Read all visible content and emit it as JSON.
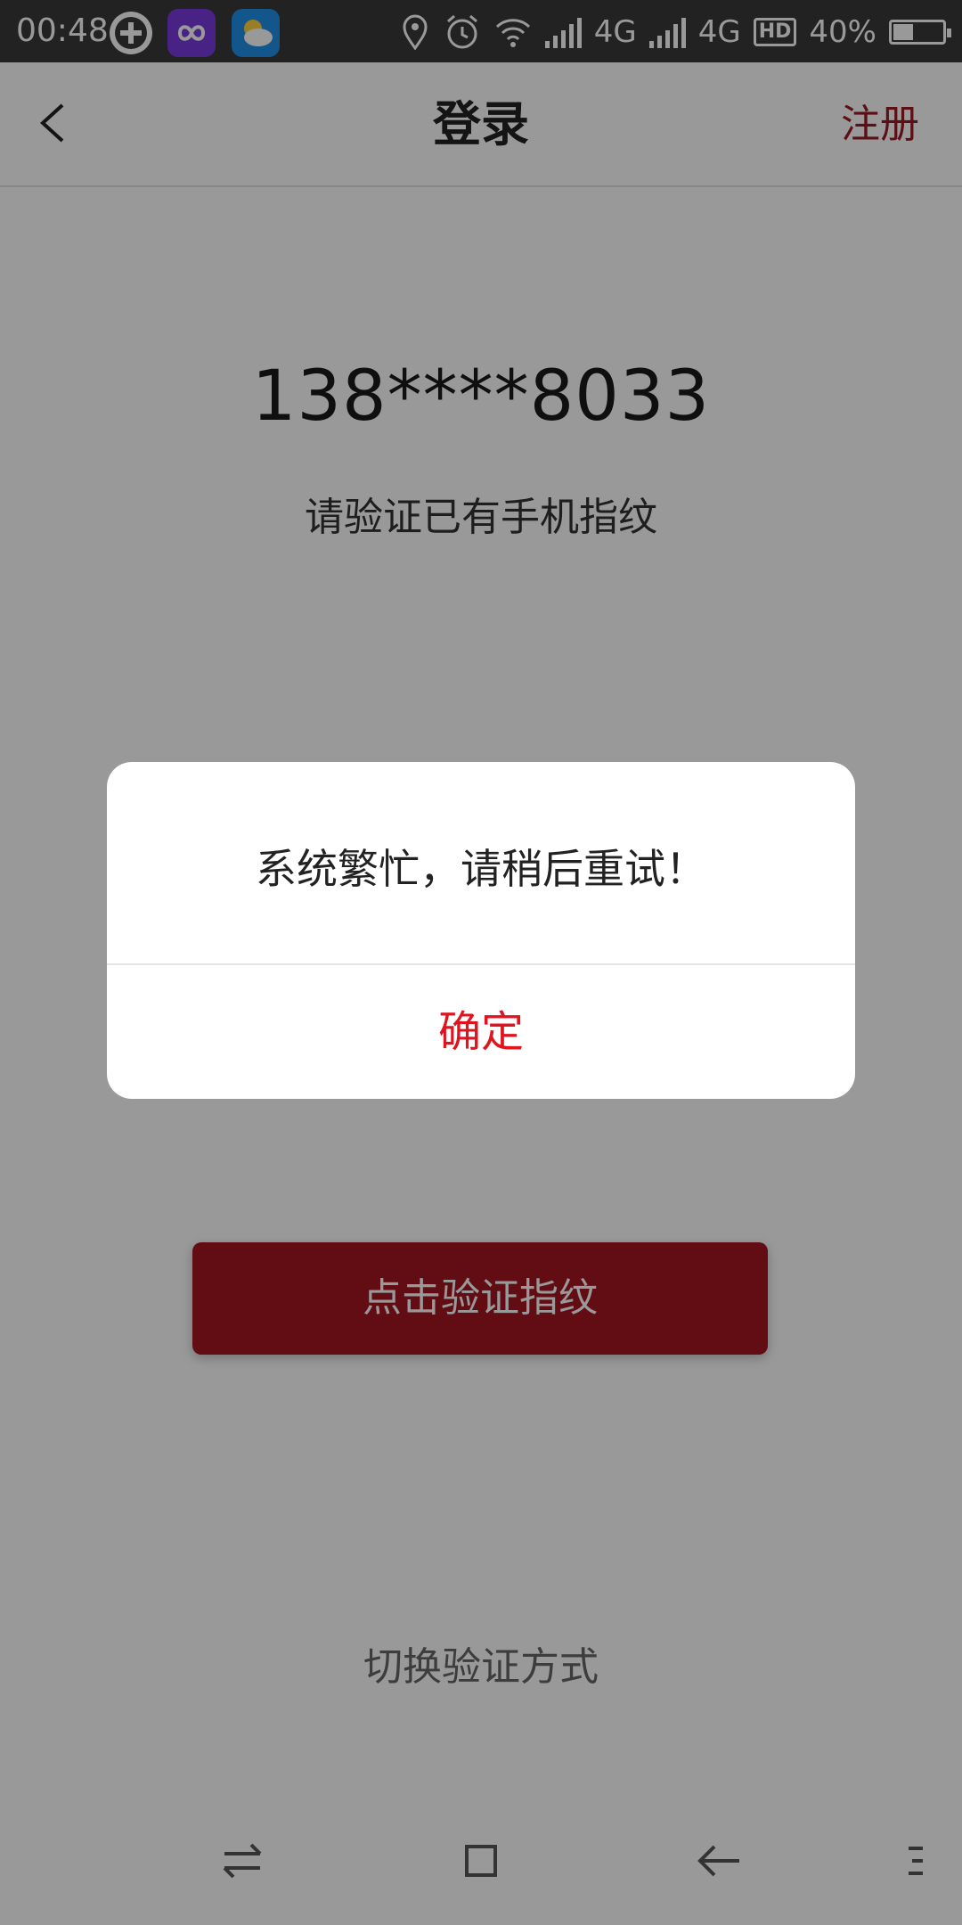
{
  "status_bar": {
    "time": "00:48",
    "network_1": "4G",
    "network_2": "4G",
    "hd_label": "HD",
    "battery_text": "40%",
    "battery_level": 0.4,
    "icons": [
      "plus-circle-icon",
      "purple-app-icon",
      "weather-icon",
      "location-icon",
      "alarm-icon",
      "wifi-icon",
      "signal-icon",
      "signal-icon",
      "hd-icon",
      "battery-icon"
    ]
  },
  "navbar": {
    "title": "登录",
    "register_label": "注册",
    "back_icon": "chevron-left-icon"
  },
  "content": {
    "phone_number": "138****8033",
    "hint": "请验证已有手机指纹",
    "fingerprint_icon": "fingerprint-icon",
    "verify_button_label": "点击验证指纹",
    "switch_method_label": "切换验证方式"
  },
  "dialog": {
    "message": "系统繁忙，请稍后重试！",
    "confirm_label": "确定"
  },
  "system_nav": {
    "icons": [
      "switch-icon",
      "home-square-icon",
      "back-arrow-icon",
      "menu-icon"
    ]
  },
  "colors": {
    "brand_red": "#a31520",
    "confirm_red": "#e0141e",
    "register_red": "#9c1a25"
  }
}
